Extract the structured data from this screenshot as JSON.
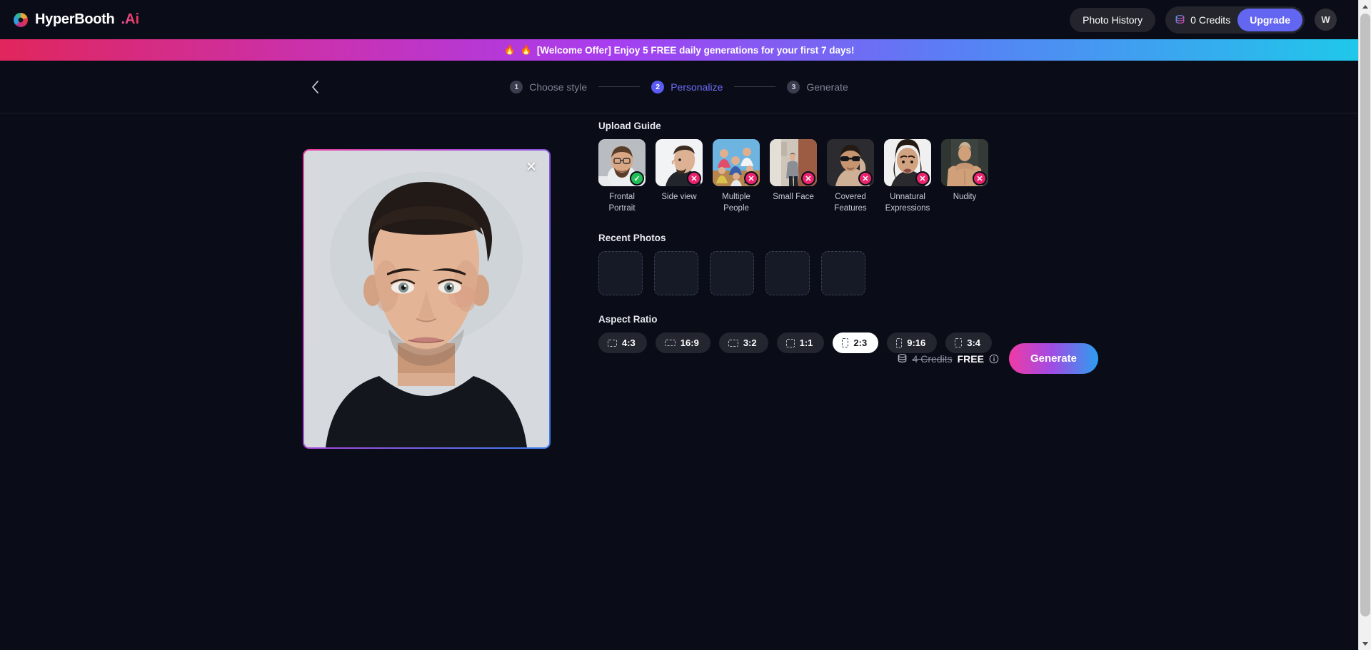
{
  "header": {
    "brand_name": "HyperBooth",
    "brand_suffix": ".Ai",
    "logo_icon": "aperture-icon",
    "photo_history_label": "Photo History",
    "credits_icon": "coin-stack-icon",
    "credits_label": "0 Credits",
    "upgrade_label": "Upgrade",
    "avatar_initial": "W"
  },
  "banner": {
    "flame_icon": "fire-emoji",
    "flame1": "🔥",
    "flame2": "🔥",
    "text": "[Welcome Offer] Enjoy 5 FREE daily generations for your first 7 days!"
  },
  "stepper": {
    "back_icon": "chevron-left-icon",
    "steps": [
      {
        "num": "1",
        "label": "Choose style",
        "active": false
      },
      {
        "num": "2",
        "label": "Personalize",
        "active": true
      },
      {
        "num": "3",
        "label": "Generate",
        "active": false
      }
    ]
  },
  "photo": {
    "close_icon": "close-icon",
    "alt": "uploaded frontal portrait of young man with short dark hair in black t-shirt"
  },
  "upload_guide": {
    "title": "Upload Guide",
    "items": [
      {
        "label": "Frontal Portrait",
        "status": "ok",
        "badge": "✓"
      },
      {
        "label": "Side view",
        "status": "no",
        "badge": "✕"
      },
      {
        "label": "Multiple People",
        "status": "no",
        "badge": "✕"
      },
      {
        "label": "Small Face",
        "status": "no",
        "badge": "✕"
      },
      {
        "label": "Covered Features",
        "status": "no",
        "badge": "✕"
      },
      {
        "label": "Unnatural Expressions",
        "status": "no",
        "badge": "✕"
      },
      {
        "label": "Nudity",
        "status": "no",
        "badge": "✕"
      }
    ]
  },
  "recent_photos": {
    "title": "Recent Photos",
    "slots": [
      "",
      "",
      "",
      "",
      ""
    ]
  },
  "aspect_ratio": {
    "title": "Aspect Ratio",
    "selected": "2:3",
    "options": [
      {
        "label": "4:3",
        "w": 13,
        "h": 10
      },
      {
        "label": "16:9",
        "w": 15,
        "h": 9
      },
      {
        "label": "3:2",
        "w": 14,
        "h": 10
      },
      {
        "label": "1:1",
        "w": 12,
        "h": 12
      },
      {
        "label": "2:3",
        "w": 9,
        "h": 13
      },
      {
        "label": "9:16",
        "w": 8,
        "h": 14
      },
      {
        "label": "3:4",
        "w": 10,
        "h": 13
      }
    ]
  },
  "action": {
    "credits_icon": "coin-stack-icon",
    "price_old": "4 Credits",
    "price_free": "FREE",
    "info_icon": "info-circle-icon",
    "generate_label": "Generate"
  },
  "colors": {
    "background": "#0a0d18",
    "accent_purple": "#5b5bf5",
    "upgrade": "#6366f1",
    "badge_ok": "#21bf55",
    "badge_no": "#e9246d"
  }
}
